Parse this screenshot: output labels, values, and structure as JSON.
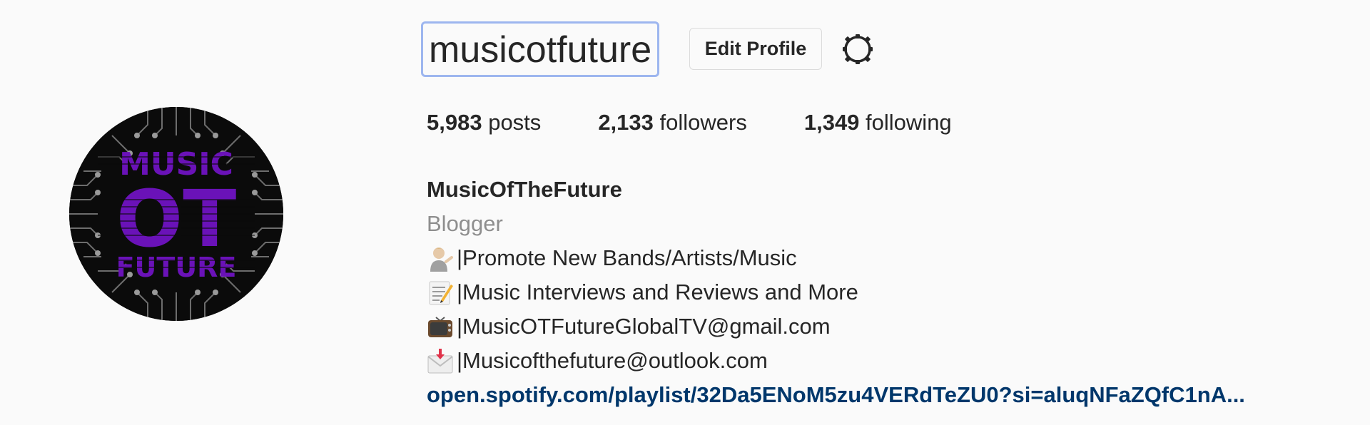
{
  "profile": {
    "username": "musicotfuture",
    "edit_label": "Edit Profile",
    "settings_icon": "gear-icon",
    "avatar_icon": "circuit-logo",
    "avatar_text": [
      "MUSIC",
      "OT",
      "FUTURE"
    ]
  },
  "stats": {
    "posts_count": "5,983",
    "posts_label": "posts",
    "followers_count": "2,133",
    "followers_label": "followers",
    "following_count": "1,349",
    "following_label": "following"
  },
  "bio": {
    "name": "MusicOfTheFuture",
    "category": "Blogger",
    "lines": [
      {
        "icon": "person-tipping-hand-icon",
        "text": "|Promote New Bands/Artists/Music"
      },
      {
        "icon": "memo-icon",
        "text": "|Music Interviews and Reviews and More"
      },
      {
        "icon": "television-icon",
        "text": "|MusicOTFutureGlobalTV@gmail.com"
      },
      {
        "icon": "incoming-envelope-icon",
        "text": "|Musicofthefuture@outlook.com"
      }
    ],
    "link": "open.spotify.com/playlist/32Da5ENoM5zu4VERdTeZU0?si=aluqNFaZQfC1nA..."
  },
  "colors": {
    "background": "#fafafa",
    "text": "#262626",
    "muted": "#8e8e8e",
    "link": "#00376b",
    "focus_border": "#9db6ef",
    "avatar_purple": "#6a12b8"
  }
}
